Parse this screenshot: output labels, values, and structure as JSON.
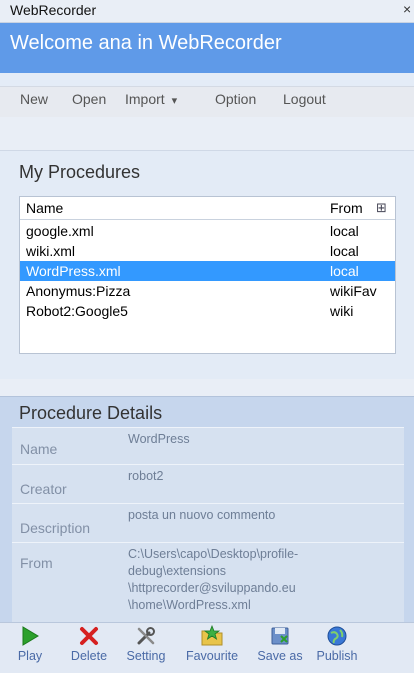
{
  "window": {
    "title": "WebRecorder",
    "close_glyph": "×"
  },
  "welcome": {
    "text": "Welcome ana in WebRecorder"
  },
  "menu": {
    "new": "New",
    "open": "Open",
    "import": "Import",
    "import_arrow": "▾",
    "option": "Option",
    "logout": "Logout"
  },
  "procedures": {
    "title": "My Procedures",
    "columns": {
      "name": "Name",
      "from": "From",
      "column_chooser_glyph": "⊞"
    },
    "rows": [
      {
        "name": "google.xml",
        "from": "local"
      },
      {
        "name": "wiki.xml",
        "from": "local"
      },
      {
        "name": "WordPress.xml",
        "from": "local",
        "selected": true
      },
      {
        "name": "Anonymus:Pizza",
        "from": "wikiFav"
      },
      {
        "name": "Robot2:Google5",
        "from": "wiki"
      }
    ],
    "selection_color": "#3399ff"
  },
  "details": {
    "title": "Procedure Details",
    "name_label": "Name",
    "name_value": "WordPress",
    "creator_label": "Creator",
    "creator_value": "robot2",
    "description_label": "Description",
    "description_value": "posta un nuovo commento",
    "from_label": "From",
    "from_lines": [
      "C:\\Users\\capo\\Desktop\\profile-",
      "debug\\extensions",
      "\\httprecorder@sviluppando.eu",
      "\\home\\WordPress.xml"
    ]
  },
  "toolbar": {
    "play": "Play",
    "delete": "Delete",
    "setting": "Setting",
    "favourite": "Favourite",
    "save_as": "Save as",
    "publish": "Publish"
  },
  "colors": {
    "header_blue": "#5f9ae8",
    "toolbar_text": "#4a6aa6"
  }
}
